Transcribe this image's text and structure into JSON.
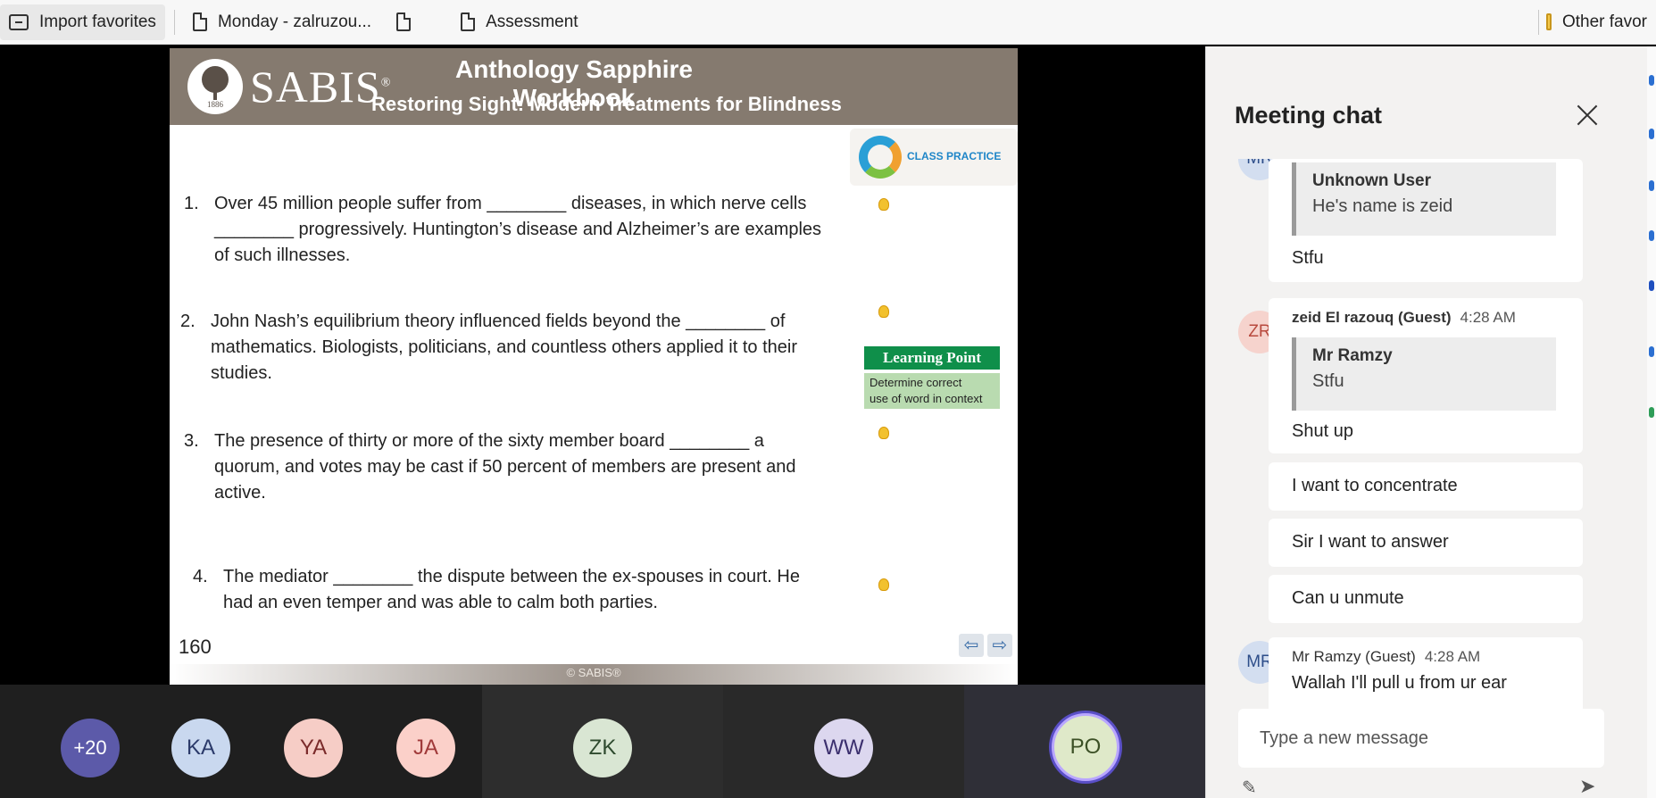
{
  "bookmarks": {
    "items": [
      {
        "label": "Import favorites",
        "icon": "import-icon"
      },
      {
        "label": "Monday - zalruzou...",
        "icon": "page-icon"
      },
      {
        "label": "",
        "icon": "page-icon"
      },
      {
        "label": "Assessment",
        "icon": "page-icon"
      }
    ],
    "other_label": "Other favor"
  },
  "slide": {
    "brand": "SABIS",
    "brand_mark": "®",
    "logo_year": "1886",
    "title": "Anthology Sapphire Workbook",
    "subtitle": "Restoring Sight: Modern Treatments for Blindness",
    "class_practice": "CLASS PRACTICE",
    "questions": [
      {
        "num": "1.",
        "lines": [
          "Over 45 million people suffer from ________ diseases, in which nerve cells",
          "________ progressively. Huntington’s disease and Alzheimer’s are examples",
          "of such illnesses."
        ]
      },
      {
        "num": "2.",
        "lines": [
          "John Nash’s equilibrium theory influenced fields beyond the ________ of",
          "mathematics. Biologists, politicians, and countless others applied it to their",
          "studies."
        ]
      },
      {
        "num": "3.",
        "lines": [
          "The presence of thirty or more of the sixty member board ________ a",
          "quorum, and votes may be cast if 50 percent of members are present and",
          "active."
        ]
      },
      {
        "num": "4.",
        "lines": [
          "The mediator ________ the dispute between the ex-spouses in court. He",
          "had an even temper and was able to calm both parties."
        ]
      }
    ],
    "learning_point": {
      "head": "Learning Point",
      "body_line1": "Determine correct",
      "body_line2": "use of word in context"
    },
    "page_number": "160",
    "prev_arrow": "⇦",
    "next_arrow": "⇨",
    "footer": "© SABIS®"
  },
  "participants": [
    {
      "initials": "+20"
    },
    {
      "initials": "KA"
    },
    {
      "initials": "YA"
    },
    {
      "initials": "JA"
    },
    {
      "initials": "ZK"
    },
    {
      "initials": "WW"
    },
    {
      "initials": "PO"
    }
  ],
  "chat": {
    "title": "Meeting chat",
    "messages": [
      {
        "avatar": "MR",
        "quote_name": "Unknown User",
        "quote_text": "He's name is zeid",
        "text": "Stfu"
      },
      {
        "avatar": "ZR",
        "name": "zeid El razouq (Guest)",
        "time": "4:28 AM",
        "quote_name": "Mr Ramzy",
        "quote_text": "Stfu",
        "text": "Shut up"
      },
      {
        "text": "I want to concentrate"
      },
      {
        "text": "Sir I want to answer"
      },
      {
        "text": "Can u unmute"
      },
      {
        "avatar": "MR",
        "name": "Mr Ramzy (Guest)",
        "time": "4:28 AM",
        "text": "Wallah I'll pull u from ur ear"
      }
    ],
    "compose_placeholder": "Type a new message"
  }
}
